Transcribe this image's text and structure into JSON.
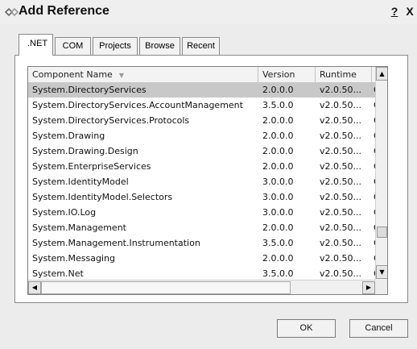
{
  "window": {
    "title": "Add Reference",
    "help_label": "?",
    "close_label": "X"
  },
  "tabs": [
    {
      "label": ".NET",
      "active": true
    },
    {
      "label": "COM",
      "active": false
    },
    {
      "label": "Projects",
      "active": false
    },
    {
      "label": "Browse",
      "active": false
    },
    {
      "label": "Recent",
      "active": false
    }
  ],
  "list": {
    "columns": [
      "Component Name",
      "Version",
      "Runtime",
      "P"
    ],
    "sort_indicator": "▼",
    "rows": [
      {
        "name": "System.DirectoryServices",
        "version": "2.0.0.0",
        "runtime": "v2.0.50...",
        "path": "C",
        "selected": true
      },
      {
        "name": "System.DirectoryServices.AccountManagement",
        "version": "3.5.0.0",
        "runtime": "v2.0.50...",
        "path": "C"
      },
      {
        "name": "System.DirectoryServices.Protocols",
        "version": "2.0.0.0",
        "runtime": "v2.0.50...",
        "path": "C"
      },
      {
        "name": "System.Drawing",
        "version": "2.0.0.0",
        "runtime": "v2.0.50...",
        "path": "C"
      },
      {
        "name": "System.Drawing.Design",
        "version": "2.0.0.0",
        "runtime": "v2.0.50...",
        "path": "C"
      },
      {
        "name": "System.EnterpriseServices",
        "version": "2.0.0.0",
        "runtime": "v2.0.50...",
        "path": "C"
      },
      {
        "name": "System.IdentityModel",
        "version": "3.0.0.0",
        "runtime": "v2.0.50...",
        "path": "C"
      },
      {
        "name": "System.IdentityModel.Selectors",
        "version": "3.0.0.0",
        "runtime": "v2.0.50...",
        "path": "C"
      },
      {
        "name": "System.IO.Log",
        "version": "3.0.0.0",
        "runtime": "v2.0.50...",
        "path": "C"
      },
      {
        "name": "System.Management",
        "version": "2.0.0.0",
        "runtime": "v2.0.50...",
        "path": "C"
      },
      {
        "name": "System.Management.Instrumentation",
        "version": "3.5.0.0",
        "runtime": "v2.0.50...",
        "path": "C"
      },
      {
        "name": "System.Messaging",
        "version": "2.0.0.0",
        "runtime": "v2.0.50...",
        "path": "C"
      },
      {
        "name": "System.Net",
        "version": "3.5.0.0",
        "runtime": "v2.0.50...",
        "path": "C"
      }
    ]
  },
  "buttons": {
    "ok": "OK",
    "cancel": "Cancel"
  },
  "icons": {
    "title": "reference-link-icon",
    "scroll_up": "scroll-up-arrow-icon",
    "scroll_down": "scroll-down-arrow-icon",
    "scroll_left": "scroll-left-arrow-icon",
    "scroll_right": "scroll-right-arrow-icon"
  },
  "colors": {
    "selected_row": "#c8c8c8",
    "window_bg": "#ececec"
  }
}
